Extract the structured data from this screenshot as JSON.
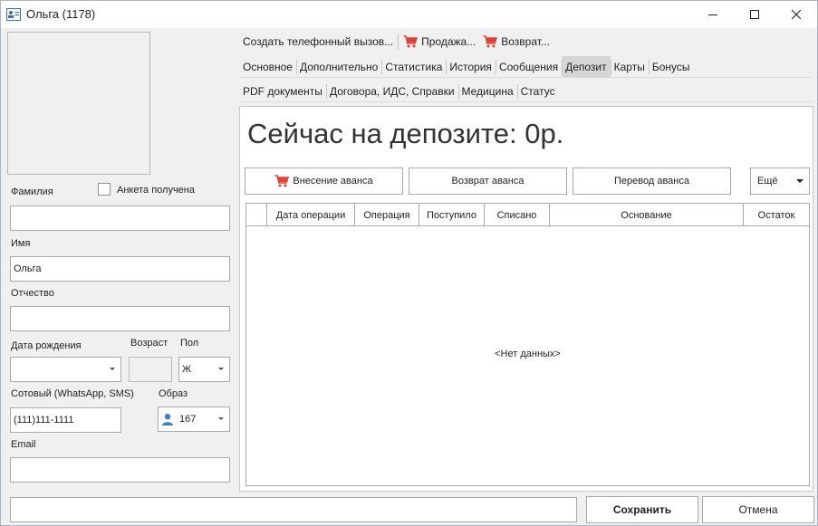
{
  "window": {
    "title": "Ольга  (1178)",
    "icon": "contact-card-icon"
  },
  "form": {
    "lastname_label": "Фамилия",
    "lastname_value": "",
    "survey_label": "Анкета получена",
    "survey_checked": false,
    "firstname_label": "Имя",
    "firstname_value": "Ольга",
    "middlename_label": "Отчество",
    "middlename_value": "",
    "birthdate_label": "Дата рождения",
    "birthdate_value": "",
    "age_label": "Возраст",
    "age_value": "",
    "gender_label": "Пол",
    "gender_value": "Ж",
    "phone_label": "Сотовый (WhatsApp, SMS)",
    "phone_value": "(111)111-1111",
    "image_label": "Образ",
    "image_value": "167",
    "email_label": "Email",
    "email_value": ""
  },
  "toolbar": {
    "create_call": "Создать телефонный вызов...",
    "sales": "Продажа...",
    "return": "Возврат..."
  },
  "tabs_row1": [
    "Основное",
    "Дополнительно",
    "Статистика",
    "История",
    "Сообщения",
    "Депозит",
    "Карты",
    "Бонусы"
  ],
  "tabs_row2": [
    "PDF документы",
    "Договора, ИДС, Справки",
    "Медицина",
    "Статус"
  ],
  "active_tab": "Депозит",
  "deposit": {
    "headline": "Сейчас на депозите: 0р.",
    "add_advance": "Внесение аванса",
    "return_advance": "Возврат аванса",
    "transfer_advance": "Перевод аванса",
    "more": "Ещё",
    "columns": [
      "",
      "Дата операции",
      "Операция",
      "Поступило",
      "Списано",
      "Основание",
      "Остаток"
    ],
    "empty_text": "<Нет данных>"
  },
  "footer": {
    "status_value": "",
    "save": "Сохранить",
    "cancel": "Отмена"
  },
  "colors": {
    "cart": "#d9433a",
    "avatar": "#3f7fc4",
    "active_tab": "#d6d6d6"
  }
}
